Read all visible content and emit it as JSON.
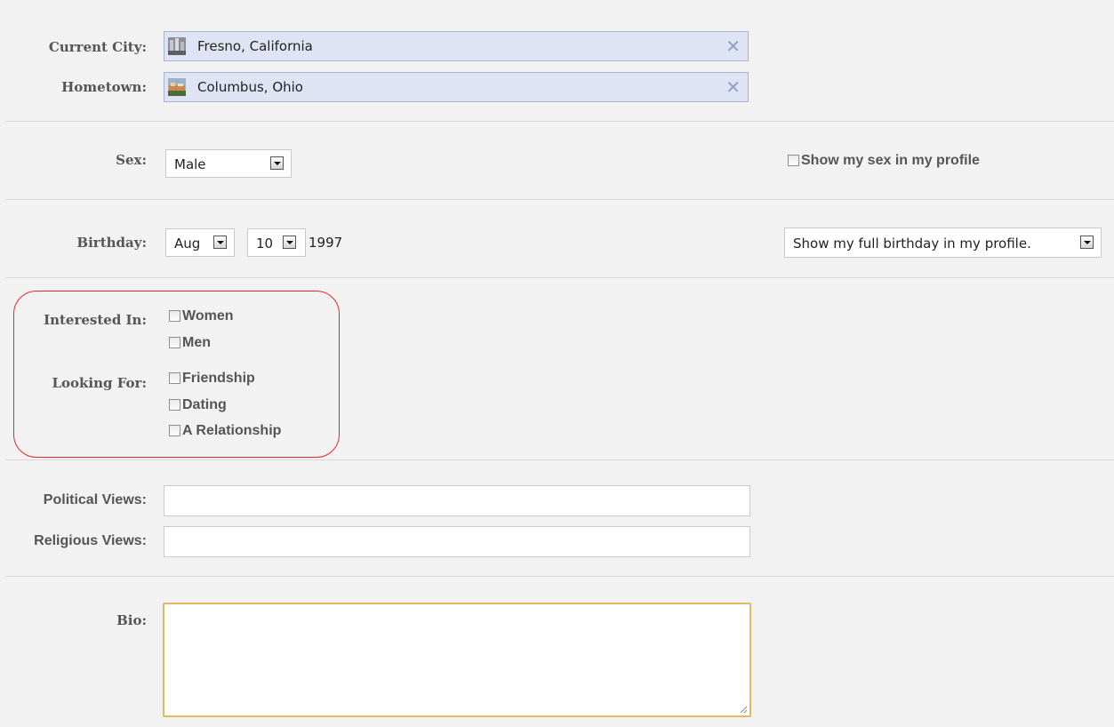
{
  "location": {
    "current_city_label": "Current City:",
    "current_city_value": "Fresno, California",
    "hometown_label": "Hometown:",
    "hometown_value": "Columbus, Ohio"
  },
  "sex": {
    "label": "Sex:",
    "value": "Male",
    "show_in_profile_label": "Show my sex in my profile"
  },
  "birthday": {
    "label": "Birthday:",
    "month": "Aug",
    "day": "10",
    "year": "1997",
    "visibility": "Show my full birthday in my profile."
  },
  "interested_in": {
    "label": "Interested In:",
    "options": [
      "Women",
      "Men"
    ]
  },
  "looking_for": {
    "label": "Looking For:",
    "options": [
      "Friendship",
      "Dating",
      "A Relationship"
    ]
  },
  "views": {
    "political_label": "Political Views:",
    "political_value": "",
    "religious_label": "Religious Views:",
    "religious_value": ""
  },
  "bio": {
    "label": "Bio:",
    "value": ""
  },
  "colors": {
    "token_bg": "#dfe4f4",
    "highlight": "#e8272d",
    "bio_focus_border": "#e2b860"
  }
}
